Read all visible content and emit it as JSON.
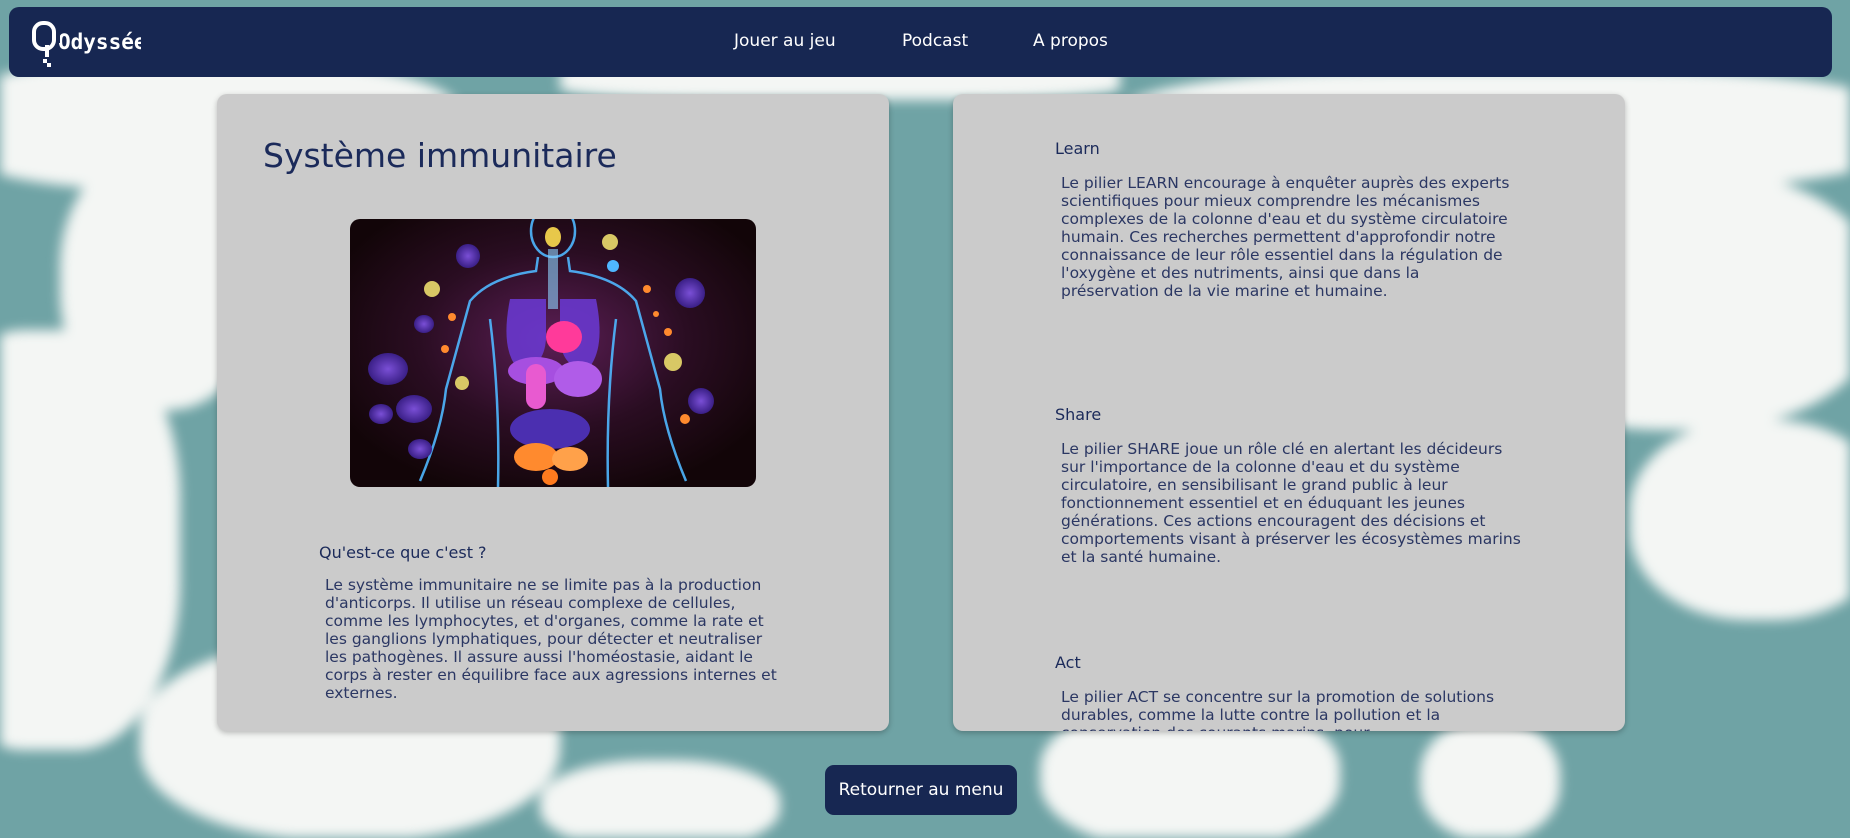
{
  "brand": {
    "logo_text": "Odyssée"
  },
  "nav": {
    "items": [
      {
        "label": "Jouer au jeu"
      },
      {
        "label": "Podcast"
      },
      {
        "label": "A propos"
      }
    ]
  },
  "main": {
    "title": "Système immunitaire",
    "image_subject": "illustration of the human body with glowing organs surrounded by cells and microbes",
    "what_is_it": {
      "heading": "Qu'est-ce que c'est ?",
      "text": "Le système immunitaire ne se limite pas à la production d'anticorps. Il utilise un réseau complexe de cellules, comme les lymphocytes, et d'organes, comme la rate et les ganglions lymphatiques, pour détecter et neutraliser les pathogènes. Il assure aussi l'homéostasie, aidant le corps à rester en équilibre face aux agressions internes et externes."
    }
  },
  "pillars": {
    "learn": {
      "heading": "Learn",
      "text": "Le pilier LEARN encourage à enquêter auprès des experts scientifiques pour mieux comprendre les mécanismes complexes de la colonne d'eau et du système circulatoire humain. Ces recherches permettent d'approfondir notre connaissance de leur rôle essentiel dans la régulation de l'oxygène et des nutriments, ainsi que dans la préservation de la vie marine et humaine."
    },
    "share": {
      "heading": "Share",
      "text": "Le pilier SHARE joue un rôle clé en alertant les décideurs sur l'importance de la colonne d'eau et du système circulatoire, en sensibilisant le grand public à leur fonctionnement essentiel et en éduquant les jeunes générations. Ces actions encouragent des décisions et comportements visant à préserver les écosystèmes marins et la santé humaine."
    },
    "act": {
      "heading": "Act",
      "text": "Le pilier ACT se concentre sur la promotion de solutions durables, comme la lutte contre la pollution et la conservation des courants marins, pour"
    }
  },
  "footer": {
    "back_label": "Retourner au menu"
  },
  "colors": {
    "navbar": "#172752",
    "card": "#cbcbcb",
    "ocean": "#6fa3a5",
    "land": "#f4f6f4",
    "text": "#1b2a5a"
  }
}
